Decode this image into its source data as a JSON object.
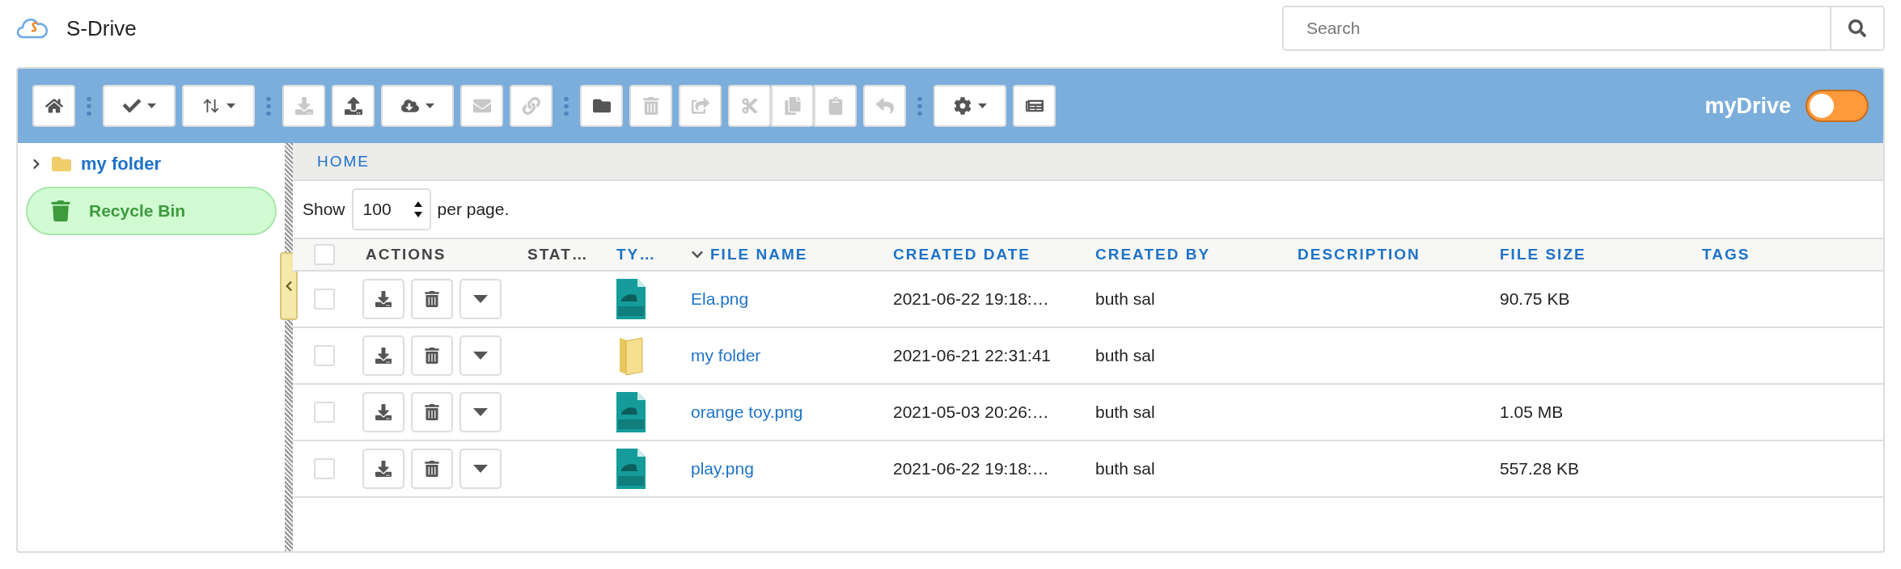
{
  "app": {
    "title": "S-Drive"
  },
  "search": {
    "placeholder": "Search"
  },
  "toolbar": {
    "groups": [
      {
        "items": [
          {
            "disabled": false,
            "dropdown": false,
            "attached": false
          }
        ]
      },
      {
        "items": [
          {
            "disabled": false,
            "dropdown": true,
            "attached": false
          },
          {
            "disabled": false,
            "dropdown": true,
            "attached": false
          }
        ]
      },
      {
        "items": [
          {
            "disabled": true,
            "dropdown": false,
            "attached": false
          },
          {
            "disabled": false,
            "dropdown": false,
            "attached": false
          },
          {
            "disabled": false,
            "dropdown": true,
            "attached": false
          },
          {
            "disabled": true,
            "dropdown": false,
            "attached": false
          },
          {
            "disabled": true,
            "dropdown": false,
            "attached": false
          }
        ]
      },
      {
        "items": [
          {
            "disabled": false,
            "dropdown": false,
            "attached": false
          },
          {
            "disabled": true,
            "dropdown": false,
            "attached": false
          },
          {
            "disabled": true,
            "dropdown": false,
            "attached": false
          },
          {
            "disabled": true,
            "dropdown": false,
            "attached": false
          },
          {
            "disabled": true,
            "dropdown": false,
            "attached": true
          },
          {
            "disabled": true,
            "dropdown": false,
            "attached": true
          },
          {
            "disabled": true,
            "dropdown": false,
            "attached": false
          }
        ]
      },
      {
        "items": [
          {
            "disabled": false,
            "dropdown": true,
            "attached": false
          },
          {
            "disabled": false,
            "dropdown": false,
            "attached": false
          }
        ]
      }
    ],
    "toggle": {
      "label": "myDrive",
      "on": false
    }
  },
  "sidebar": {
    "items": [
      {
        "kind": "folder",
        "label": "my folder",
        "expanded": false,
        "selected": false
      },
      {
        "kind": "recycle",
        "label": "Recycle Bin",
        "selected": true
      }
    ]
  },
  "breadcrumb": [
    "HOME"
  ],
  "pager": {
    "before": "Show",
    "value": "100",
    "after": "per page."
  },
  "table": {
    "all_checked": false,
    "columns": [
      {
        "label": "ACTIONS",
        "sortable": false,
        "sorted": false
      },
      {
        "label": "STAT…",
        "sortable": false,
        "sorted": false
      },
      {
        "label": "TY…",
        "sortable": true,
        "sorted": false
      },
      {
        "label": "FILE NAME",
        "sortable": true,
        "sorted": true
      },
      {
        "label": "CREATED DATE",
        "sortable": true,
        "sorted": false
      },
      {
        "label": "CREATED BY",
        "sortable": true,
        "sorted": false
      },
      {
        "label": "DESCRIPTION",
        "sortable": true,
        "sorted": false
      },
      {
        "label": "FILE SIZE",
        "sortable": true,
        "sorted": false
      },
      {
        "label": "TAGS",
        "sortable": true,
        "sorted": false
      }
    ],
    "rows": [
      {
        "checked": false,
        "kind": "png",
        "name": "Ela.png",
        "created_date": "2021-06-22 19:18:…",
        "created_by": "buth sal",
        "file_size": "90.75 KB"
      },
      {
        "checked": false,
        "kind": "folder",
        "name": "my folder",
        "created_date": "2021-06-21 22:31:41",
        "created_by": "buth sal"
      },
      {
        "checked": false,
        "kind": "png",
        "name": "orange toy.png",
        "created_date": "2021-05-03 20:26:…",
        "created_by": "buth sal",
        "file_size": "1.05 MB"
      },
      {
        "checked": false,
        "kind": "png",
        "name": "play.png",
        "created_date": "2021-06-22 19:18:…",
        "created_by": "buth sal",
        "file_size": "557.28 KB"
      }
    ]
  }
}
